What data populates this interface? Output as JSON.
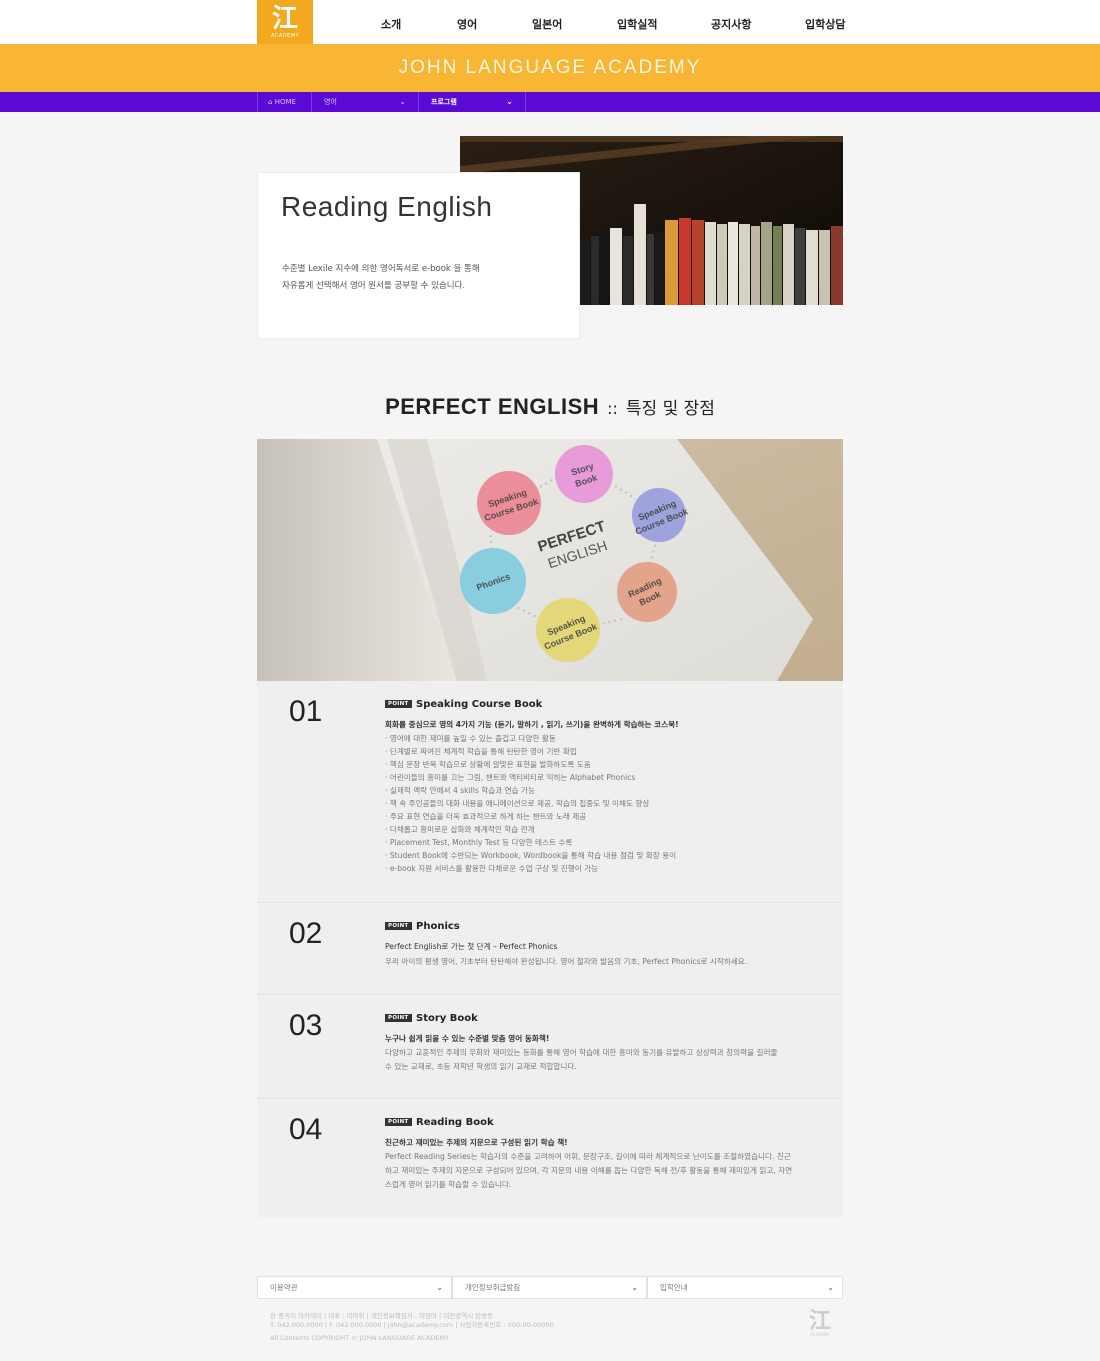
{
  "header": {
    "logo_glyph": "江",
    "logo_sub": "ACADEMY",
    "nav": [
      "소개",
      "영어",
      "일본어",
      "입학실적",
      "공지사항",
      "입학상담"
    ],
    "banner_title": "JOHN LANGUAGE ACADEMY",
    "accent_color": "#f9b534",
    "bar_color": "#5b0ad6"
  },
  "breadcrumb": {
    "home": "HOME",
    "level1": "영어",
    "level2": "프로그램"
  },
  "intro": {
    "title": "Reading English",
    "desc_line1": "수준별 Lexile 지수에 의한 영어독서로 e-book 을 통해",
    "desc_line2": "자유롭게 선택해서 영어 원서를 공부할 수 있습니다."
  },
  "section": {
    "title_en": "PERFECT ENGLISH",
    "separator": "::",
    "title_ko": "특징 및 장점"
  },
  "diagram": {
    "center_line1": "PERFECT",
    "center_line2": "ENGLISH",
    "nodes": [
      {
        "line1": "Story",
        "line2": "Book",
        "color": "#e79bd8"
      },
      {
        "line1": "Speaking",
        "line2": "Course Book",
        "color": "#9ea3dd"
      },
      {
        "line1": "Reading",
        "line2": "Book",
        "color": "#e4a48b"
      },
      {
        "line1": "Speaking",
        "line2": "Course Book",
        "color": "#e4d77a"
      },
      {
        "line1": "Phonics",
        "line2": "",
        "color": "#89cde0"
      },
      {
        "line1": "Speaking",
        "line2": "Course Book",
        "color": "#eb8e99"
      }
    ]
  },
  "points": [
    {
      "num": "01",
      "badge": "POINT",
      "title": "Speaking Course Book",
      "lead": "회화를 중심으로 영의 4가지 기능 (듣기, 말하기 , 읽기, 쓰기)을 완벽하게 학습하는 코스북!",
      "items": [
        "영어에 대한 재미를 높일 수 있는 즐겁고 다양한 활동",
        "단계별로 짜여진 체계적 학습을 통해 탄탄한 영어 기반 확립",
        "핵심 문장 반복 학습으로 상황에 알맞은 표현을 발화하도록 도움",
        "어린이들의 흥미를 끄는 그림, 챈트와 액티비티로 익히는 Alphabet Phonics",
        "실제적 맥락 안에서 4 skills 학습과 연습 가능",
        "책 속 주인공들의 대화 내용을 애니메이션으로 제공, 학습의 집중도 및 이해도 향상",
        "주요 표현 연습을 더욱 효과적으로 하게 하는 챈트와 노래 제공",
        "다채롭고 흥미로운 삽화와 체계적인 학습 전개",
        "Placement Test, Monthly Test 등 다양한 테스트 수록",
        "Student Book에 수반되는 Workbook, Wordbook을 통해 학습 내용 점검 및 확장 용이",
        "e-book 지원 서비스를 활용한 다채로운 수업 구상 및 진행이 가능"
      ]
    },
    {
      "num": "02",
      "badge": "POINT",
      "title": "Phonics",
      "lead": "Perfect English로 가는 첫 단계 – Perfect Phonics",
      "desc": "우리 아이의 평생 영어, 기초부터 탄탄해야 완성됩니다. 영어 철자와 발음의 기초, Perfect Phonics로 시작하세요."
    },
    {
      "num": "03",
      "badge": "POINT",
      "title": "Story Book",
      "lead": "누구나 쉽게 읽을 수 있는 수준별 맞춤 영어 동화책!",
      "desc": "다양하고 교훈적인 주제의 우화와 재미있는 동화를 통해 영어 학습에 대한 흥미와 동기를 유발하고 상상력과 창의력을 길러줄 수 있는 교재로, 초등 저학년 학생의 읽기 교재로 적합합니다."
    },
    {
      "num": "04",
      "badge": "POINT",
      "title": "Reading Book",
      "lead": "친근하고 재미있는 주제의 지문으로 구성된 읽기 학습 책!",
      "desc": "Perfect Reading Series는 학습자의 수준을 고려하여 어휘, 문장구조, 길이에 따라 체계적으로 난이도를 조절하였습니다. 친근하고 재미있는 주제의 지문으로 구성되어 있으며, 각 지문의 내용 이해를 돕는 다양한 독해 전/후 활동을 통해 재미있게 읽고, 자연스럽게 영어 읽기를 학습할 수 있습니다."
    }
  ],
  "footer": {
    "selects": [
      "이용약관",
      "개인정보취급방침",
      "입학안내"
    ],
    "info_line1": "잔 랭귀지 아카데미 | 대표 : 이아휘 | 개인정보책임자 : 이엄마 | 대전광역시 탄방동",
    "info_line2": "T. 042.000.0000 | F. 042.000.0000 | john@academy.com | 사업자등록번호 : 000-00-00000",
    "copyright": "All Contents COPYRIGHT © JOHN LANGUAGE ACADEMY",
    "logo_glyph": "江",
    "logo_sub": "ACADEMY"
  }
}
